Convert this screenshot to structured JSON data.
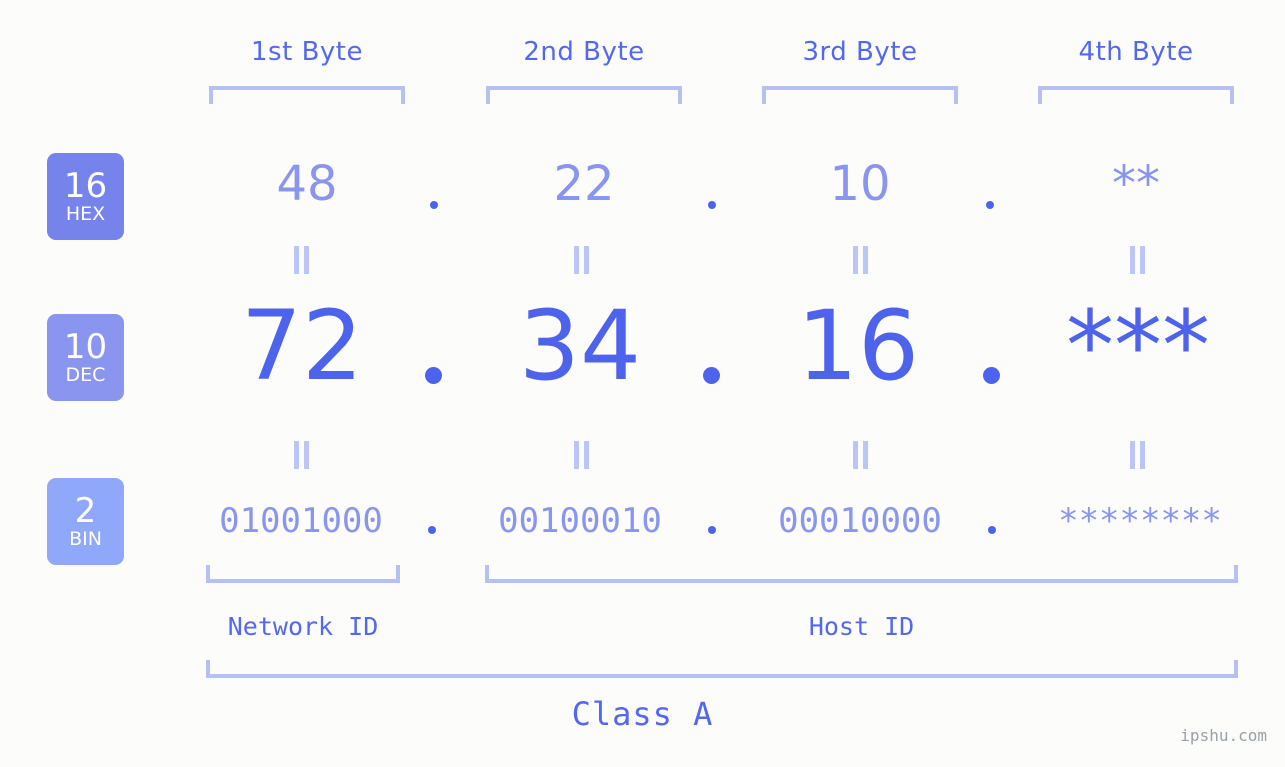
{
  "background_color": "#fcfdfa",
  "accent_colors": {
    "strong": "#4e63ec",
    "header_text": "#5468ef",
    "mid": "#8a95ef",
    "light": "#b6c0f4",
    "badge_hex": "#7583ea",
    "badge_dec": "#8a95ef",
    "badge_bin": "#8fa8fa"
  },
  "byte_headers": [
    {
      "label": "1st Byte"
    },
    {
      "label": "2nd Byte"
    },
    {
      "label": "3rd Byte"
    },
    {
      "label": "4th Byte"
    }
  ],
  "rows": [
    {
      "base_number": "16",
      "base_name": "HEX",
      "values": [
        "48",
        "22",
        "10",
        "**"
      ],
      "separator": "."
    },
    {
      "base_number": "10",
      "base_name": "DEC",
      "values": [
        "72",
        "34",
        "16",
        "***"
      ],
      "separator": "."
    },
    {
      "base_number": "2",
      "base_name": "BIN",
      "values": [
        "01001000",
        "00100010",
        "00010000",
        "********"
      ],
      "separator": "."
    }
  ],
  "equals_marker": "=",
  "id_sections": [
    {
      "label": "Network ID"
    },
    {
      "label": "Host ID"
    }
  ],
  "class_label": "Class A",
  "watermark": "ipshu.com"
}
